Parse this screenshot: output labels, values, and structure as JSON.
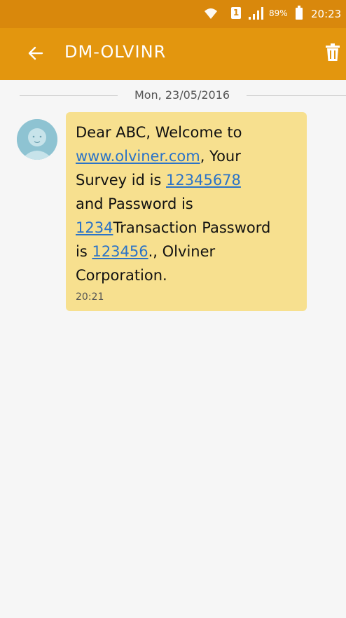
{
  "status_bar": {
    "sim_slot": "1",
    "battery_percent": "89%",
    "time": "20:23"
  },
  "header": {
    "title": "DM-OLVINR",
    "back_icon": "arrow-left-icon",
    "delete_icon": "trash-icon"
  },
  "conversation": {
    "date": "Mon, 23/05/2016",
    "message": {
      "greeting": "Dear ABC, Welcome to",
      "website": "www.olviner.com",
      "after_website": ", Your",
      "survey_prefix": "Survey id is ",
      "survey_id": "12345678",
      "password_prefix": "and Password is",
      "password": "1234",
      "after_password": "Transaction Password",
      "txn_prefix": "is ",
      "txn_password": "123456",
      "after_txn": "., Olviner",
      "sign_off": "Corporation.",
      "time": "20:21"
    }
  },
  "colors": {
    "status_bar": "#d9880c",
    "app_bar": "#e3960e",
    "bubble": "#f7e08f",
    "link": "#2b73c7"
  }
}
